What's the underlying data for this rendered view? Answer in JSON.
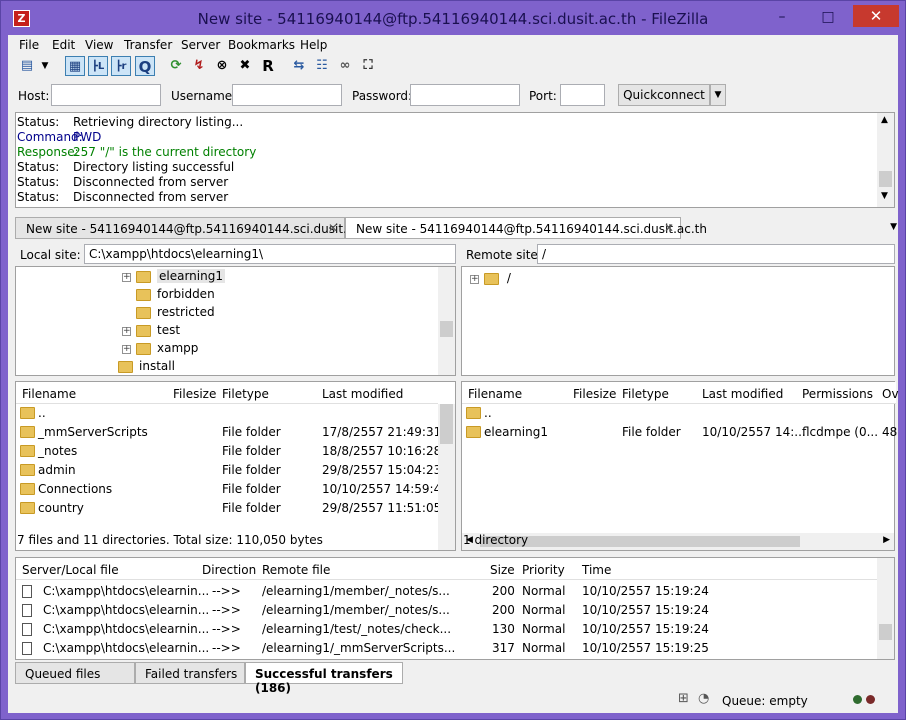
{
  "window": {
    "title": "New site - 54116940144@ftp.54116940144.sci.dusit.ac.th - FileZilla",
    "icon": "filezilla-icon",
    "close": "✕",
    "minimize": "–",
    "maximize": "□"
  },
  "menu": [
    "File",
    "Edit",
    "View",
    "Transfer",
    "Server",
    "Bookmarks",
    "Help"
  ],
  "toolbar_icons": [
    "site-manager-icon",
    "dropdown-arrow-icon",
    "toggle-message-log-icon",
    "toggle-local-tree-icon",
    "toggle-remote-tree-icon",
    "toggle-queue-icon",
    "refresh-icon",
    "process-queue-icon",
    "cancel-icon",
    "disconnect-icon",
    "reconnect-icon",
    "compare-icon",
    "filter-icon",
    "sync-browse-icon",
    "search-icon"
  ],
  "quickconnect": {
    "host_label": "Host:",
    "username_label": "Username:",
    "password_label": "Password:",
    "port_label": "Port:",
    "button": "Quickconnect",
    "host": "",
    "username": "",
    "password": "",
    "port": ""
  },
  "log": [
    {
      "k": "Status:",
      "v": "Retrieving directory listing...",
      "color": "#000000"
    },
    {
      "k": "Command:",
      "v": "PWD",
      "color": "#00008b"
    },
    {
      "k": "Response:",
      "v": "257 \"/\" is the current directory",
      "color": "#008000"
    },
    {
      "k": "Status:",
      "v": "Directory listing successful",
      "color": "#000000"
    },
    {
      "k": "Status:",
      "v": "Disconnected from server",
      "color": "#000000"
    },
    {
      "k": "Status:",
      "v": "Disconnected from server",
      "color": "#000000"
    }
  ],
  "tabs": [
    {
      "label": "New site - 54116940144@ftp.54116940144.sci.dusit.ac.th",
      "close": "✕",
      "active": false
    },
    {
      "label": "New site - 54116940144@ftp.54116940144.sci.dusit.ac.th",
      "close": "✕",
      "active": true
    }
  ],
  "local": {
    "site_label": "Local site:",
    "path": "C:\\xampp\\htdocs\\elearning1\\",
    "tree": [
      {
        "name": "elearning1",
        "expander": "+",
        "selected": true
      },
      {
        "name": "forbidden",
        "expander": ""
      },
      {
        "name": "restricted",
        "expander": ""
      },
      {
        "name": "test",
        "expander": "+"
      },
      {
        "name": "xampp",
        "expander": "+"
      },
      {
        "name": "install",
        "expander": ""
      }
    ],
    "columns": [
      "Filename",
      "Filesize",
      "Filetype",
      "Last modified"
    ],
    "files": [
      {
        "name": "..",
        "size": "",
        "type": "",
        "modified": ""
      },
      {
        "name": "_mmServerScripts",
        "size": "",
        "type": "File folder",
        "modified": "17/8/2557 21:49:31"
      },
      {
        "name": "_notes",
        "size": "",
        "type": "File folder",
        "modified": "18/8/2557 10:16:28"
      },
      {
        "name": "admin",
        "size": "",
        "type": "File folder",
        "modified": "29/8/2557 15:04:23"
      },
      {
        "name": "Connections",
        "size": "",
        "type": "File folder",
        "modified": "10/10/2557 14:59:49"
      },
      {
        "name": "country",
        "size": "",
        "type": "File folder",
        "modified": "29/8/2557 11:51:05"
      }
    ],
    "status": "7 files and 11 directories. Total size: 110,050 bytes"
  },
  "remote": {
    "site_label": "Remote site:",
    "path": "/",
    "tree": [
      {
        "name": "/",
        "expander": "+"
      }
    ],
    "columns": [
      "Filename",
      "Filesize",
      "Filetype",
      "Last modified",
      "Permissions",
      "Ov"
    ],
    "files": [
      {
        "name": "..",
        "size": "",
        "type": "",
        "modified": "",
        "perm": "",
        "owner": ""
      },
      {
        "name": "elearning1",
        "size": "",
        "type": "File folder",
        "modified": "10/10/2557 14:...",
        "perm": "flcdmpe (0...",
        "owner": "48"
      }
    ],
    "status": "1 directory"
  },
  "queue": {
    "columns": [
      "Server/Local file",
      "Direction",
      "Remote file",
      "Size",
      "Priority",
      "Time"
    ],
    "rows": [
      {
        "local": "C:\\xampp\\htdocs\\elearnin...",
        "dir": "-->>",
        "remote": "/elearning1/member/_notes/s...",
        "size": "200",
        "priority": "Normal",
        "time": "10/10/2557 15:19:24"
      },
      {
        "local": "C:\\xampp\\htdocs\\elearnin...",
        "dir": "-->>",
        "remote": "/elearning1/member/_notes/s...",
        "size": "200",
        "priority": "Normal",
        "time": "10/10/2557 15:19:24"
      },
      {
        "local": "C:\\xampp\\htdocs\\elearnin...",
        "dir": "-->>",
        "remote": "/elearning1/test/_notes/check...",
        "size": "130",
        "priority": "Normal",
        "time": "10/10/2557 15:19:24"
      },
      {
        "local": "C:\\xampp\\htdocs\\elearnin...",
        "dir": "-->>",
        "remote": "/elearning1/_mmServerScripts...",
        "size": "317",
        "priority": "Normal",
        "time": "10/10/2557 15:19:25"
      }
    ],
    "tabs": [
      "Queued files",
      "Failed transfers",
      "Successful transfers (186)"
    ]
  },
  "statusbar": {
    "queue": "Queue: empty"
  }
}
